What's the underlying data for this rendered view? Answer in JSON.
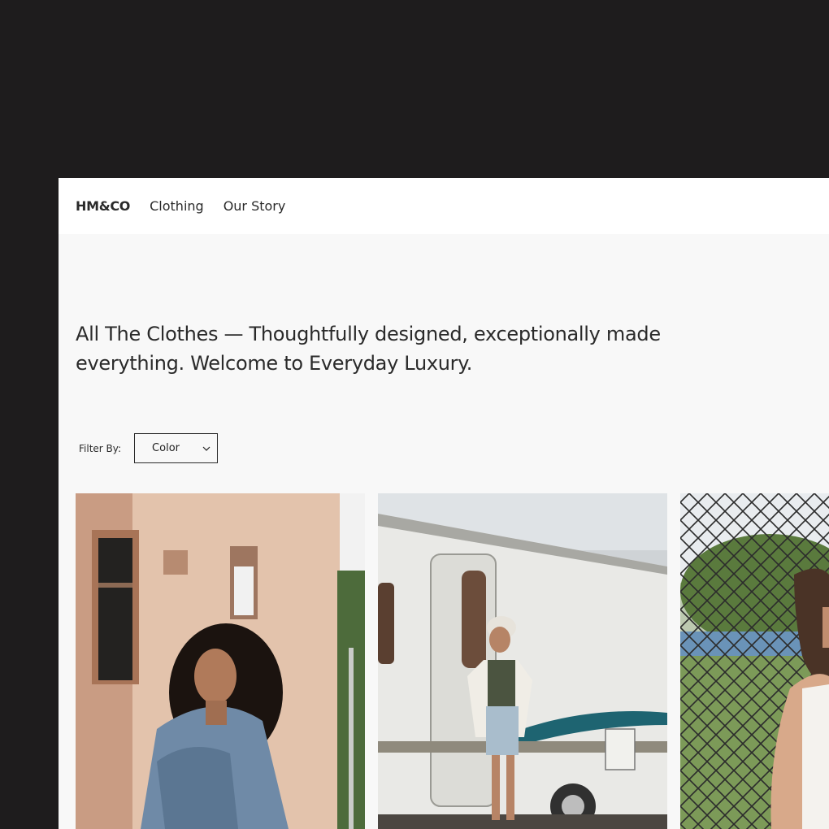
{
  "nav": {
    "brand": "HM&CO",
    "links": [
      "Clothing",
      "Our Story"
    ]
  },
  "hero": {
    "headline": "All The Clothes — Thoughtfully designed, exceptionally made everything. Welcome to Everyday Luxury."
  },
  "filter": {
    "label": "Filter By:",
    "selected": "Color"
  },
  "products": [
    {
      "image": "woman-denim-jacket-brick-building"
    },
    {
      "image": "woman-green-top-camper-trailer"
    },
    {
      "image": "woman-white-top-chainlink-fence"
    }
  ],
  "colors": {
    "backdrop": "#1e1c1d",
    "page": "#f8f8f8",
    "navbar": "#ffffff",
    "text": "#2a2a2a"
  }
}
